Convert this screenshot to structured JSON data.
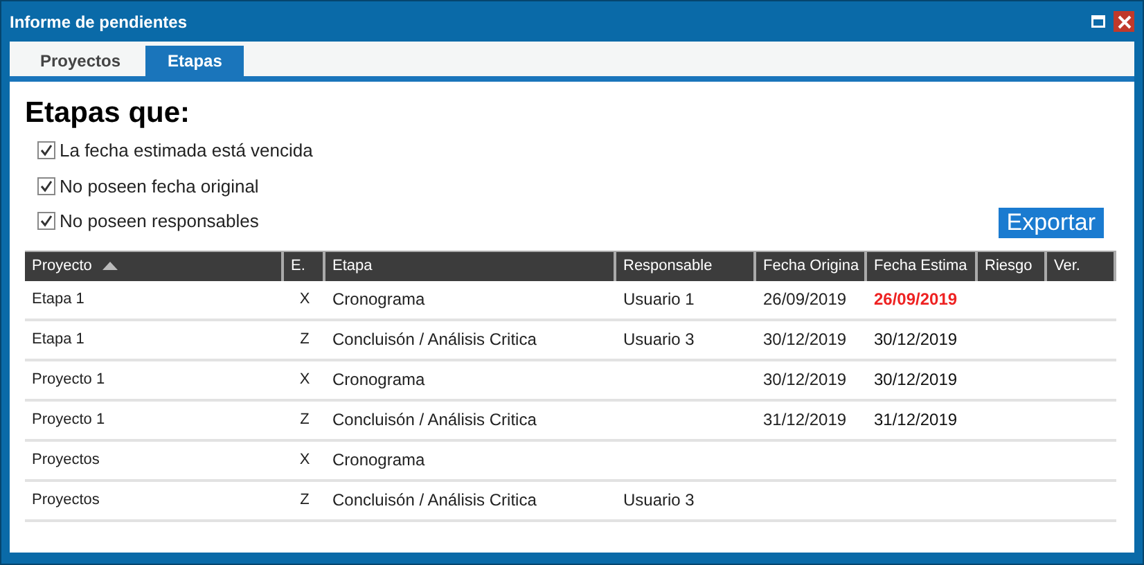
{
  "window": {
    "title": "Informe de pendientes"
  },
  "tabs": [
    {
      "label": "Proyectos",
      "selected": false
    },
    {
      "label": "Etapas",
      "selected": true
    }
  ],
  "heading": "Etapas que:",
  "filters": [
    {
      "label": "La fecha estimada está vencida",
      "checked": true
    },
    {
      "label": "No poseen fecha original",
      "checked": true
    },
    {
      "label": "No poseen responsables",
      "checked": true
    }
  ],
  "export_button": "Exportar",
  "table": {
    "columns": [
      {
        "label": "Proyecto",
        "sorted": true
      },
      {
        "label": "E.",
        "sorted": false
      },
      {
        "label": "Etapa",
        "sorted": false
      },
      {
        "label": "Responsable",
        "sorted": false
      },
      {
        "label": "Fecha Origina",
        "sorted": false
      },
      {
        "label": "Fecha Estima",
        "sorted": false
      },
      {
        "label": "Riesgo",
        "sorted": false
      },
      {
        "label": "Ver.",
        "sorted": false
      }
    ],
    "rows": [
      {
        "proyecto": "Etapa 1",
        "e": "X",
        "etapa": "Cronograma",
        "responsable": "Usuario 1",
        "fecha_original": "26/09/2019",
        "fecha_estimada": "26/09/2019",
        "overdue": true
      },
      {
        "proyecto": "Etapa 1",
        "e": "Z",
        "etapa": "Concluisón / Análisis Critica",
        "responsable": "Usuario 3",
        "fecha_original": "30/12/2019",
        "fecha_estimada": "30/12/2019",
        "overdue": false
      },
      {
        "proyecto": "Proyecto 1",
        "e": "X",
        "etapa": "Cronograma",
        "fecha_original": "30/12/2019",
        "fecha_estimada": "30/12/2019",
        "overdue": false
      },
      {
        "proyecto": "Proyecto 1",
        "e": "Z",
        "etapa": "Concluisón / Análisis Critica",
        "fecha_original": "31/12/2019",
        "fecha_estimada": "31/12/2019",
        "overdue": false
      },
      {
        "proyecto": "Proyectos",
        "e": "X",
        "etapa": "Cronograma"
      },
      {
        "proyecto": "Proyectos",
        "e": "Z",
        "etapa": "Concluisón / Análisis Critica",
        "responsable": "Usuario 3"
      }
    ]
  }
}
